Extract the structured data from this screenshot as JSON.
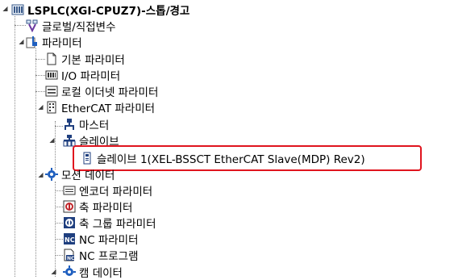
{
  "tree": {
    "root": {
      "label": "LSPLC(XGI-CPUZ7)-스톱/경고",
      "icon": "plc-station-icon"
    },
    "items": [
      {
        "label": "글로벌/직접변수",
        "icon": "global-variables-icon"
      },
      {
        "label": "파라미터",
        "icon": "parameter-folder-icon",
        "expanded": true
      },
      {
        "label": "기본 파라미터",
        "icon": "document-icon"
      },
      {
        "label": "I/O 파라미터",
        "icon": "io-module-icon"
      },
      {
        "label": "로컬 이더넷 파라미터",
        "icon": "ethernet-icon"
      },
      {
        "label": "EtherCAT 파라미터",
        "icon": "ethercat-icon",
        "expanded": true
      },
      {
        "label": "마스터",
        "icon": "master-icon"
      },
      {
        "label": "슬레이브",
        "icon": "slave-group-icon",
        "expanded": true
      },
      {
        "label": "슬레이브 1(XEL-BSSCT EtherCAT Slave(MDP) Rev2)",
        "icon": "slave-device-icon",
        "selected": true
      },
      {
        "label": "모션 데이터",
        "icon": "motion-gear-icon",
        "expanded": true
      },
      {
        "label": "엔코더 파라미터",
        "icon": "encoder-icon"
      },
      {
        "label": "축 파라미터",
        "icon": "axis-icon"
      },
      {
        "label": "축 그룹 파라미터",
        "icon": "axis-group-icon"
      },
      {
        "label": "NC 파라미터",
        "icon": "nc-icon"
      },
      {
        "label": "NC 프로그램",
        "icon": "nc-program-icon"
      },
      {
        "label": "캠 데이터",
        "icon": "cam-data-icon"
      }
    ]
  },
  "colors": {
    "highlight_border": "#e0141e",
    "tree_line": "#8a8a8a"
  }
}
